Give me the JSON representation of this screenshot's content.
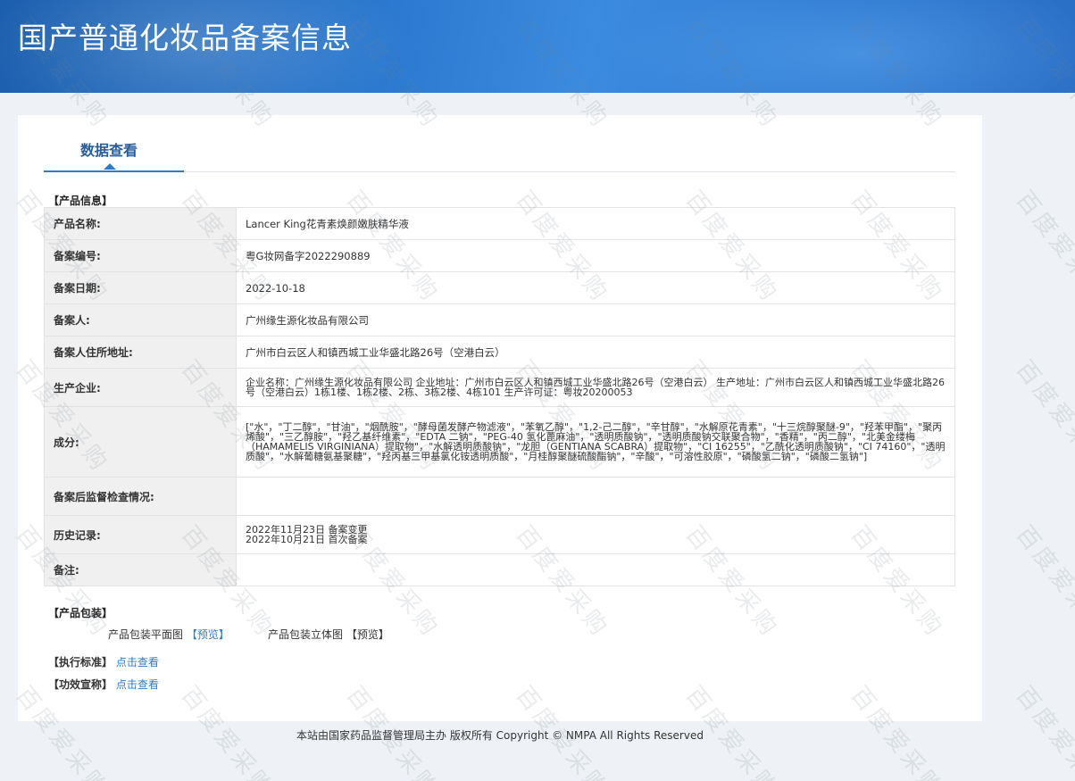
{
  "header": {
    "title": "国产普通化妆品备案信息"
  },
  "tabs": [
    {
      "label": "数据查看",
      "active": true
    }
  ],
  "product_section_title": "【产品信息】",
  "product_info": [
    {
      "label": "产品名称:",
      "value": "Lancer King花青素焕颜嫩肤精华液"
    },
    {
      "label": "备案编号:",
      "value": "粤G妆网备字2022290889"
    },
    {
      "label": "备案日期:",
      "value": "2022-10-18"
    },
    {
      "label": "备案人:",
      "value": "广州缘生源化妆品有限公司"
    },
    {
      "label": "备案人住所地址:",
      "value": "广州市白云区人和镇西城工业华盛北路26号（空港白云）"
    },
    {
      "label": "生产企业:",
      "value": "企业名称：广州缘生源化妆品有限公司 企业地址：广州市白云区人和镇西城工业华盛北路26号（空港白云） 生产地址：广州市白云区人和镇西城工业华盛北路26号（空港白云）1栋1楼、1栋2楼、2栋、3栋2楼、4栋101 生产许可证：粤妆20200053"
    },
    {
      "label": "成分:",
      "value": "[\"水\"，\"丁二醇\"，\"甘油\"，\"烟酰胺\"，\"酵母菌发酵产物滤液\"，\"苯氧乙醇\"，\"1,2-己二醇\"，\"辛甘醇\"，\"水解原花青素\"，\"十三烷醇聚醚-9\"，\"羟苯甲酯\"，\"聚丙烯酸\"，\"三乙醇胺\"，\"羟乙基纤维素\"，\"EDTA 二钠\"，\"PEG-40 氢化蓖麻油\"，\"透明质酸钠\"，\"透明质酸钠交联聚合物\"，\"香精\"，\"丙二醇\"，\"北美金缕梅（HAMAMELIS VIRGINIANA）提取物\"，\"水解透明质酸钠\"，\"龙胆（GENTIANA SCABRA）提取物\"，\"CI 16255\"，\"乙酰化透明质酸钠\"，\"CI 74160\"，\"透明质酸\"，\"水解葡糖氨基聚糖\"，\"羟丙基三甲基氯化铵透明质酸\"，\"月桂醇聚醚硫酸酯钠\"，\"辛酸\"，\"可溶性胶原\"，\"磷酸氢二钠\"，\"磷酸二氢钠\"]"
    },
    {
      "label": "备案后监督检查情况:",
      "value": ""
    },
    {
      "label": "历史记录:",
      "value_lines": [
        "2022年11月23日 备案变更",
        "2022年10月21日 首次备案"
      ]
    },
    {
      "label": "备注:",
      "value": ""
    }
  ],
  "packaging": {
    "title": "【产品包装】",
    "flat_label": "产品包装平面图",
    "flat_link": "【预览】",
    "solid_label": "产品包装立体图",
    "solid_link": "【预览】"
  },
  "standard": {
    "title": "【执行标准】",
    "link": "点击查看"
  },
  "claims": {
    "title": "【功效宣称】",
    "link": "点击查看"
  },
  "footer": {
    "text": "本站由国家药品监督管理局主办 版权所有 Copyright © NMPA All Rights Reserved"
  },
  "watermark": {
    "text": "百度爱采购"
  }
}
